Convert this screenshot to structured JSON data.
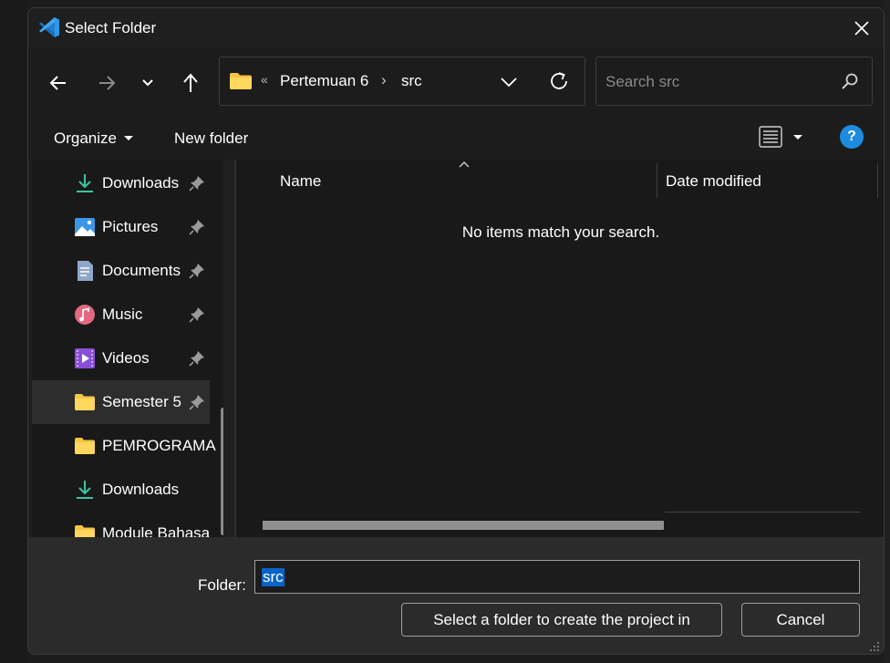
{
  "window": {
    "title": "Select Folder"
  },
  "navigation": {
    "back_icon": "arrow-left-icon",
    "forward_icon": "arrow-right-icon",
    "recent_icon": "chevron-down-icon",
    "up_icon": "arrow-up-icon"
  },
  "address": {
    "overflow": "«",
    "crumbs": [
      "Pertemuan 6",
      "src"
    ],
    "separator": "›"
  },
  "search": {
    "placeholder": "Search src"
  },
  "commands": {
    "organize": "Organize",
    "new_folder": "New folder",
    "help": "?"
  },
  "sidebar": {
    "items": [
      {
        "label": "Downloads",
        "icon": "download-icon",
        "pinned": true
      },
      {
        "label": "Pictures",
        "icon": "pictures-icon",
        "pinned": true
      },
      {
        "label": "Documents",
        "icon": "documents-icon",
        "pinned": true
      },
      {
        "label": "Music",
        "icon": "music-icon",
        "pinned": true
      },
      {
        "label": "Videos",
        "icon": "videos-icon",
        "pinned": true
      },
      {
        "label": "Semester 5",
        "icon": "folder-icon",
        "pinned": true,
        "selected": true
      },
      {
        "label": "PEMROGRAMA",
        "icon": "folder-icon",
        "pinned": false
      },
      {
        "label": "Downloads",
        "icon": "download-icon",
        "pinned": false
      },
      {
        "label": "Module Bahasa",
        "icon": "folder-icon",
        "pinned": false
      }
    ]
  },
  "filelist": {
    "columns": [
      "Name",
      "Date modified"
    ],
    "empty_message": "No items match your search."
  },
  "footer": {
    "folder_label": "Folder:",
    "folder_value": "src",
    "select_button": "Select a folder to create the project in",
    "cancel_button": "Cancel"
  },
  "colors": {
    "accent": "#1d8ce0",
    "selection": "#0a64c8",
    "folder": "#f4c542",
    "vscode_blue": "#2f97e6"
  }
}
